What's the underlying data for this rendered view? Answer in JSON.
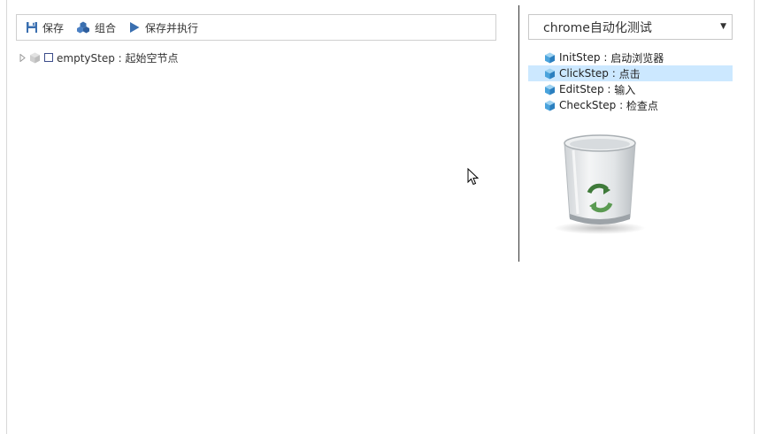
{
  "toolbar": {
    "save_label": "保存",
    "combine_label": "组合",
    "save_run_label": "保存并执行"
  },
  "tree": {
    "root": {
      "name": "emptyStep",
      "sep": " : ",
      "desc": "起始空节点"
    }
  },
  "browser_select": {
    "value": "chrome自动化测试"
  },
  "steps": [
    {
      "name": "InitStep",
      "sep": " : ",
      "desc": "启动浏览器",
      "selected": false
    },
    {
      "name": "ClickStep",
      "sep": " : ",
      "desc": "点击",
      "selected": true
    },
    {
      "name": "EditStep",
      "sep": " : ",
      "desc": "输入",
      "selected": false
    },
    {
      "name": "CheckStep",
      "sep": " : ",
      "desc": "检查点",
      "selected": false
    }
  ],
  "colors": {
    "accent": "#3a6fb0",
    "selected_bg": "#cce8ff"
  }
}
